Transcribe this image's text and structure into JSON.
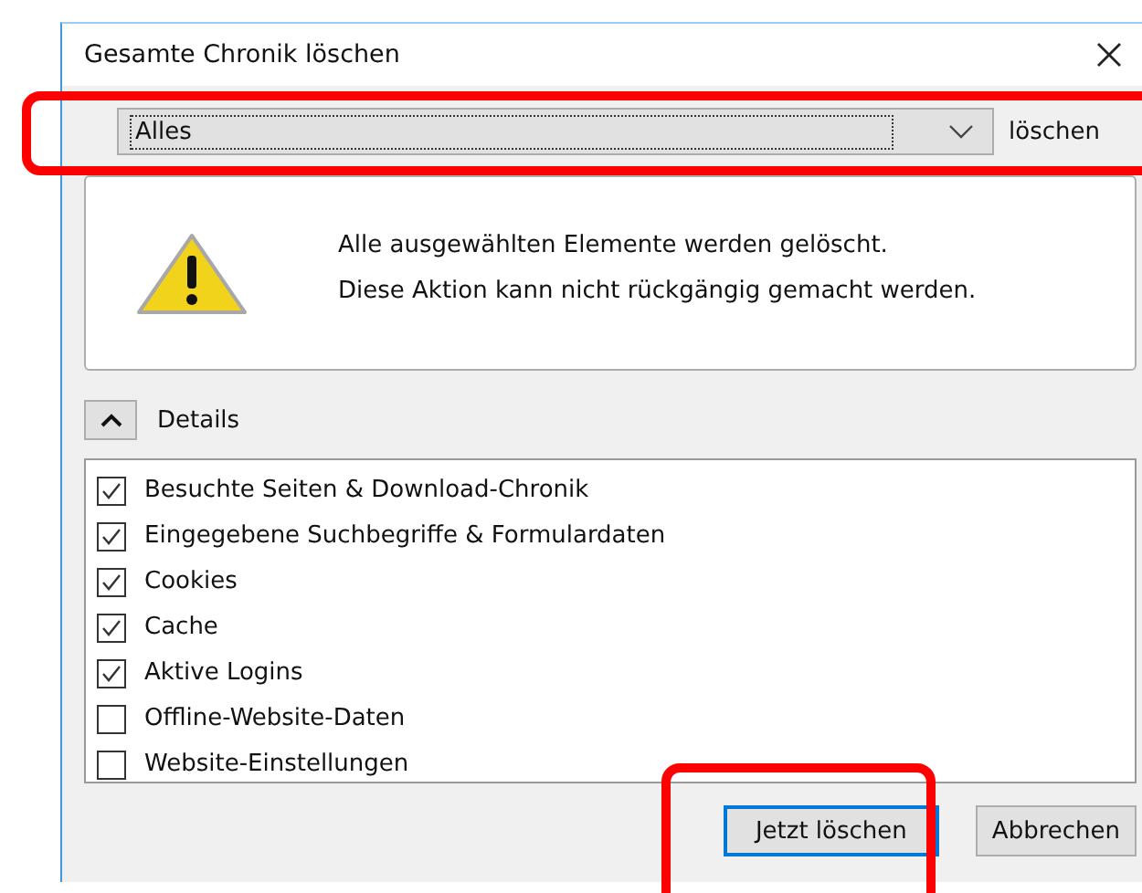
{
  "window": {
    "title": "Gesamte Chronik löschen"
  },
  "time_range": {
    "value": "Alles",
    "label": "löschen"
  },
  "warning": {
    "lines": [
      "Alle ausgewählten Elemente werden gelöscht.",
      "Diese Aktion kann nicht rückgängig gemacht werden."
    ]
  },
  "details": {
    "label": "Details",
    "expanded": true
  },
  "items": [
    {
      "label": "Besuchte Seiten & Download-Chronik",
      "checked": true
    },
    {
      "label": "Eingegebene Suchbegriffe & Formulardaten",
      "checked": true
    },
    {
      "label": "Cookies",
      "checked": true
    },
    {
      "label": "Cache",
      "checked": true
    },
    {
      "label": "Aktive Logins",
      "checked": true
    },
    {
      "label": "Offline-Website-Daten",
      "checked": false
    },
    {
      "label": "Website-Einstellungen",
      "checked": false
    }
  ],
  "buttons": [
    {
      "label": "Jetzt löschen",
      "kind": "primary"
    },
    {
      "label": "Abbrechen",
      "kind": "normal"
    }
  ]
}
